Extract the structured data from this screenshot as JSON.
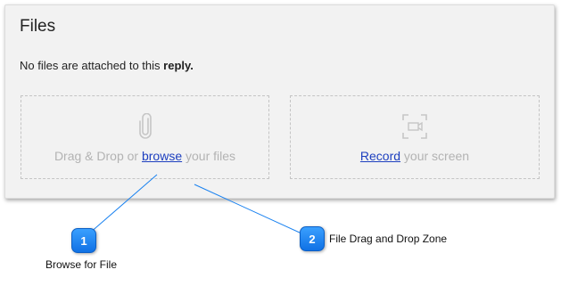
{
  "panel": {
    "title": "Files",
    "status_prefix": "No files are attached to this ",
    "status_bold": "reply."
  },
  "files_zone": {
    "icon": "paperclip-icon",
    "text_before": "Drag & Drop or ",
    "link_label": "browse",
    "text_after": " your files"
  },
  "record_zone": {
    "icon": "screen-record-icon",
    "link_label": "Record",
    "text_after": " your screen"
  },
  "callouts": [
    {
      "number": "1",
      "label": "Browse for File"
    },
    {
      "number": "2",
      "label": "File Drag and Drop Zone"
    }
  ],
  "colors": {
    "link": "#1d3fbf",
    "badge": "#1a82f0",
    "callout_line": "#1a82f0"
  }
}
